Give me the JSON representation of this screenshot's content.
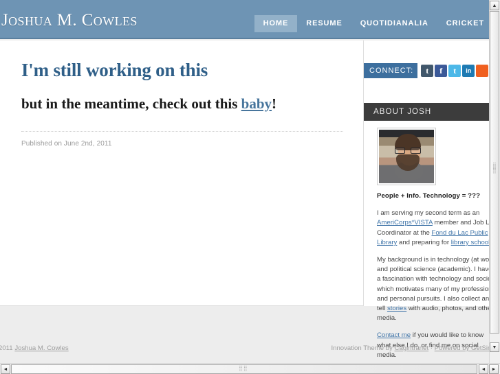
{
  "header": {
    "site_title": "Joshua M. Cowles",
    "bg_color": "#6e94b4",
    "nav": [
      {
        "label": "HOME",
        "active": true
      },
      {
        "label": "RESUME",
        "active": false
      },
      {
        "label": "QUOTIDIANALIA",
        "active": false
      },
      {
        "label": "CRICKET",
        "active": false
      }
    ]
  },
  "post": {
    "title": "I'm still working on this",
    "subtitle_before": "but in the meantime, check out this ",
    "subtitle_link": "baby",
    "subtitle_after": "!",
    "published": "Published on June 2nd, 2011",
    "title_color": "#2f5f88",
    "link_color": "#47759c"
  },
  "sidebar": {
    "connect_label": "CONNECT:",
    "connect_bg": "#3d6f9e",
    "social": [
      {
        "name": "tumblr-icon",
        "glyph": "t",
        "color": "#41576b"
      },
      {
        "name": "facebook-icon",
        "glyph": "f",
        "color": "#3b5998"
      },
      {
        "name": "twitter-icon",
        "glyph": "t",
        "color": "#4cb8e8"
      },
      {
        "name": "linkedin-icon",
        "glyph": "in",
        "color": "#1d7ab3"
      },
      {
        "name": "rss-icon",
        "glyph": "",
        "color": "#f06020"
      }
    ],
    "about_bar": "ABOUT JOSH",
    "about_bar_bg": "#3c3c3c",
    "avatar_alt": "profile-photo",
    "about_heading": "People + Info. Technology = ???",
    "about_p1_a": "I am serving my second term as an ",
    "about_p1_link1": "AmeriCorps*VISTA",
    "about_p1_b": " member and Job Lab Coordinator at the ",
    "about_p1_link2": "Fond du Lac Public Library",
    "about_p1_c": " and preparing for ",
    "about_p1_link3": "library school",
    "about_p1_d": ".",
    "about_p2_a": "My background is in technology (at work) and political science (academic). I have a fascination with technology and society which motivates many of my professional and personal pursuits. I also collect and tell ",
    "about_p2_link": "stories",
    "about_p2_b": " with audio, photos, and other media.",
    "about_p3_link": "Contact me",
    "about_p3_b": " if you would like to know what else I do, or find me on social media."
  },
  "footer": {
    "copyright_year": "2011",
    "copyright_name": "Joshua M. Cowles",
    "theme_credit_a": "Innovation Theme by ",
    "theme_credit_link": "Cagintranet",
    "theme_credit_sep": " · ",
    "powered_by": "Powered by GetSim"
  },
  "scrollbars": {
    "up_arrow": "▲",
    "down_arrow": "▼",
    "left_arrow": "◄",
    "right_arrow": "►"
  }
}
